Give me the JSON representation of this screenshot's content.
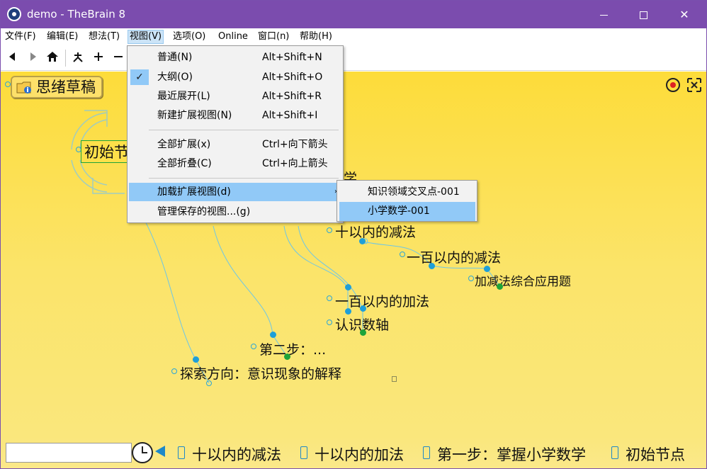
{
  "window": {
    "title": "demo - TheBrain 8",
    "minimize_icon": "minimize-icon",
    "maximize_icon": "maximize-icon",
    "close_glyph": "✕"
  },
  "menubar": {
    "items": [
      "文件(F)",
      "编辑(E)",
      "想法(T)",
      "视图(V)",
      "选项(O)",
      "Online",
      "窗口(n)",
      "帮助(H)"
    ],
    "active_index": 3
  },
  "toolbar": {
    "buttons": [
      "back-icon",
      "forward-icon",
      "home-icon",
      "layout-icon",
      "add-icon",
      "remove-icon"
    ]
  },
  "view_menu": {
    "items": [
      {
        "label": "普通(N)",
        "shortcut": "Alt+Shift+N"
      },
      {
        "label": "大纲(O)",
        "shortcut": "Alt+Shift+O",
        "checked": true
      },
      {
        "label": "最近展开(L)",
        "shortcut": "Alt+Shift+R"
      },
      {
        "label": "新建扩展视图(N)",
        "shortcut": "Alt+Shift+I"
      },
      {
        "label": "全部扩展(x)",
        "shortcut": "Ctrl+向下箭头"
      },
      {
        "label": "全部折叠(C)",
        "shortcut": "Ctrl+向上箭头"
      },
      {
        "label": "加载扩展视图(d)",
        "shortcut": "",
        "submenu": true,
        "highlighted": true
      },
      {
        "label": "管理保存的视图...(g)",
        "shortcut": ""
      }
    ],
    "check_glyph": "✓",
    "submenu_arrow": "›"
  },
  "load_submenu": {
    "items": [
      {
        "label": "知识领域交叉点-001",
        "highlighted": false
      },
      {
        "label": "小学数学-001",
        "highlighted": true
      }
    ]
  },
  "canvas": {
    "pinned_thought": "思绪草稿",
    "nodes": {
      "root": "初始节",
      "partial_top": "学",
      "sub_within_10": "十以内的减法",
      "sub_within_100": "一百以内的减法",
      "mixed_problems": "加减法综合应用题",
      "add_within_100": "一百以内的加法",
      "number_line": "认识数轴",
      "step_two": "第二步：...",
      "explore": "探索方向：意识现象的解释"
    },
    "colors": {
      "background": "#fddc3a",
      "link": "#6ec6e6",
      "gate": "#2aa6d8",
      "child_dot": "#1e9fd9",
      "jump_dot": "#1ea43a"
    }
  },
  "bottombar": {
    "search_value": "",
    "history": [
      "十以内的减法",
      "十以内的加法",
      "第一步：掌握小学数学",
      "初始节点"
    ]
  }
}
